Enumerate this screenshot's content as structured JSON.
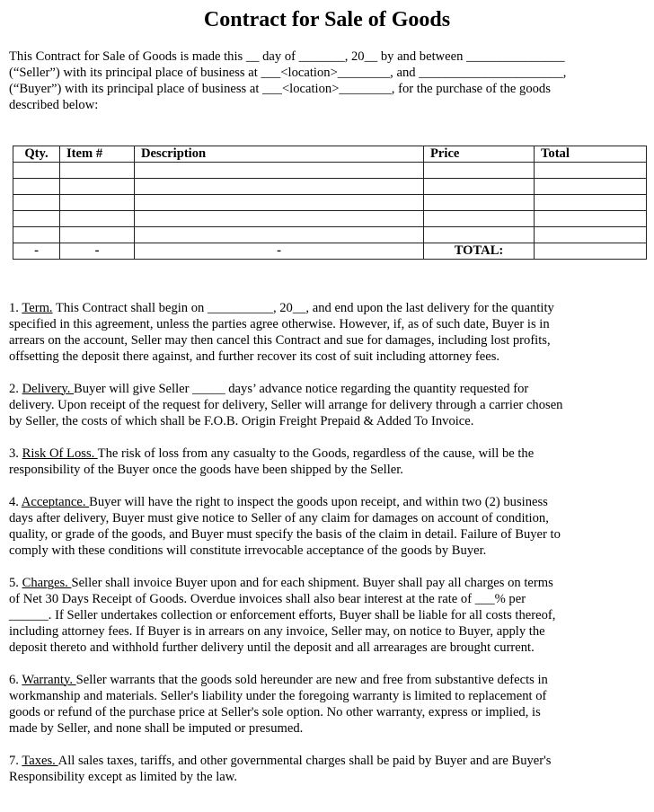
{
  "document": {
    "title": "Contract for Sale of Goods",
    "intro_lines": [
      "This Contract for Sale of Goods is made this __ day of _______, 20__ by and between _______________",
      "(“Seller”) with its principal place of business at ___<location>________, and ______________________,",
      "(“Buyer”) with its principal place of business at ___<location>________, for the purchase of the goods",
      "described below:"
    ],
    "table": {
      "headers": [
        "Qty.",
        "Item #",
        "Description",
        "Price",
        "Total"
      ],
      "rows": [
        [
          "",
          "",
          "",
          "",
          ""
        ],
        [
          "",
          "",
          "",
          "",
          ""
        ],
        [
          "",
          "",
          "",
          "",
          ""
        ],
        [
          "",
          "",
          "",
          "",
          ""
        ],
        [
          "",
          "",
          "",
          "",
          ""
        ]
      ],
      "footer": [
        "-",
        "-",
        "-",
        "TOTAL:",
        ""
      ]
    },
    "clauses": [
      {
        "number": " 1. ",
        "heading": "Term.",
        "first_rest": " This Contract shall begin on __________, 20__, and end upon the last delivery for the quantity",
        "lines": [
          "specified in this agreement, unless the parties agree otherwise. However, if, as of such date, Buyer is in",
          "arrears on the account, Seller may then cancel this Contract and sue for damages, including lost profits,",
          "offsetting the deposit there against, and further recover its cost of suit including attorney fees."
        ]
      },
      {
        "number": "2. ",
        "heading": "Delivery. ",
        "first_rest": "Buyer will give Seller _____ days’ advance notice regarding the quantity requested for",
        "lines": [
          "delivery. Upon receipt of the request for delivery, Seller will arrange for delivery through a carrier chosen",
          "by Seller, the costs of which shall be F.O.B. Origin Freight Prepaid & Added To Invoice."
        ]
      },
      {
        "number": "3. ",
        "heading": "Risk Of Loss. ",
        "first_rest": "The risk of loss from any casualty to the Goods, regardless of the cause, will be the",
        "lines": [
          "responsibility of the Buyer once the goods have been shipped by the Seller."
        ]
      },
      {
        "number": "4. ",
        "heading": "Acceptance. ",
        "first_rest": "Buyer will have the right to inspect the goods upon receipt, and within two (2) business",
        "lines": [
          "days after delivery, Buyer must give notice to Seller of any claim for damages on account of condition,",
          "quality, or grade of the goods, and Buyer must specify the basis of the claim in detail. Failure of Buyer to",
          "comply with these conditions will constitute irrevocable acceptance of the goods by Buyer."
        ]
      },
      {
        "number": "5. ",
        "heading": "Charges. ",
        "first_rest": "Seller shall invoice Buyer upon and for each shipment. Buyer shall pay all charges on terms",
        "lines": [
          "of Net 30 Days Receipt of Goods. Overdue invoices shall also bear interest at the rate of ___% per",
          "______. If Seller undertakes collection or enforcement efforts, Buyer shall be liable for all costs thereof,",
          "including attorney fees. If Buyer is in arrears on any invoice, Seller may, on notice to Buyer, apply the",
          "deposit thereto and withhold further delivery until the deposit and all arrearages are brought current."
        ]
      },
      {
        "number": "6. ",
        "heading": "Warranty. ",
        "first_rest": "Seller warrants that the goods sold hereunder are new and free from substantive defects in",
        "lines": [
          "workmanship and materials. Seller's liability under the foregoing warranty is limited to replacement of",
          "goods or refund of the purchase price at Seller's sole option. No other warranty, express or implied, is",
          "made by Seller, and none shall be imputed or presumed."
        ]
      },
      {
        "number": "7. ",
        "heading": "Taxes. ",
        "first_rest": "All sales taxes, tariffs, and other governmental charges shall be paid by Buyer and are Buyer's",
        "lines": [
          "Responsibility except as limited by the law."
        ]
      }
    ]
  }
}
